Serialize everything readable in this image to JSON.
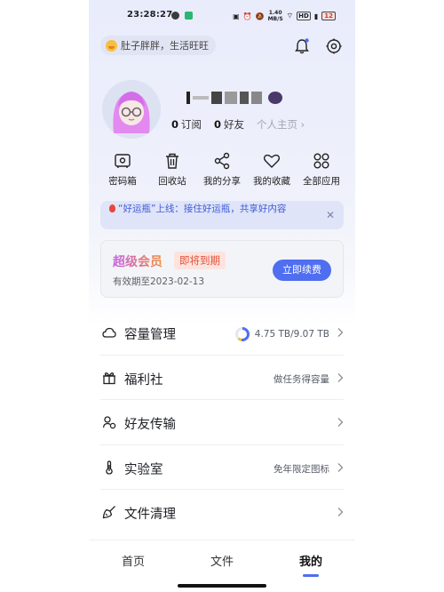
{
  "status_bar": {
    "time": "23:28:27",
    "network_speed": "1.40",
    "network_unit": "MB/S",
    "hd_label": "HD",
    "battery": "12"
  },
  "header": {
    "slogan": "肚子胖胖，生活旺旺"
  },
  "profile": {
    "stats": [
      {
        "count": "0",
        "label": "订阅"
      },
      {
        "count": "0",
        "label": "好友"
      }
    ],
    "homepage_link": "个人主页 ›"
  },
  "quick_actions": [
    {
      "label": "密码箱",
      "icon": "safe-icon"
    },
    {
      "label": "回收站",
      "icon": "trash-icon"
    },
    {
      "label": "我的分享",
      "icon": "share-icon"
    },
    {
      "label": "我的收藏",
      "icon": "heart-icon"
    },
    {
      "label": "全部应用",
      "icon": "apps-grid-icon"
    }
  ],
  "notice": {
    "text": "“好运瓶”上线：接住好运瓶，共享好内容",
    "close": "✕"
  },
  "vip": {
    "title": "超级会员",
    "tag": "即将到期",
    "expire": "有效期至2023-02-13",
    "renew_label": "立即续费"
  },
  "menu": [
    {
      "label": "容量管理",
      "value": "4.75 TB/9.07 TB",
      "icon": "cloud-icon",
      "used_fraction": 0.52
    },
    {
      "label": "福利社",
      "value": "做任务得容量",
      "icon": "gift-icon"
    },
    {
      "label": "好友传输",
      "value": "",
      "icon": "friend-transfer-icon"
    },
    {
      "label": "实验室",
      "value": "免年限定图标",
      "icon": "thermometer-icon"
    },
    {
      "label": "文件清理",
      "value": "",
      "icon": "broom-icon"
    }
  ],
  "tabs": [
    {
      "label": "首页",
      "active": false
    },
    {
      "label": "文件",
      "active": false
    },
    {
      "label": "我的",
      "active": true
    }
  ],
  "colors": {
    "accent": "#4f6ef0",
    "warning": "#e0513b"
  }
}
